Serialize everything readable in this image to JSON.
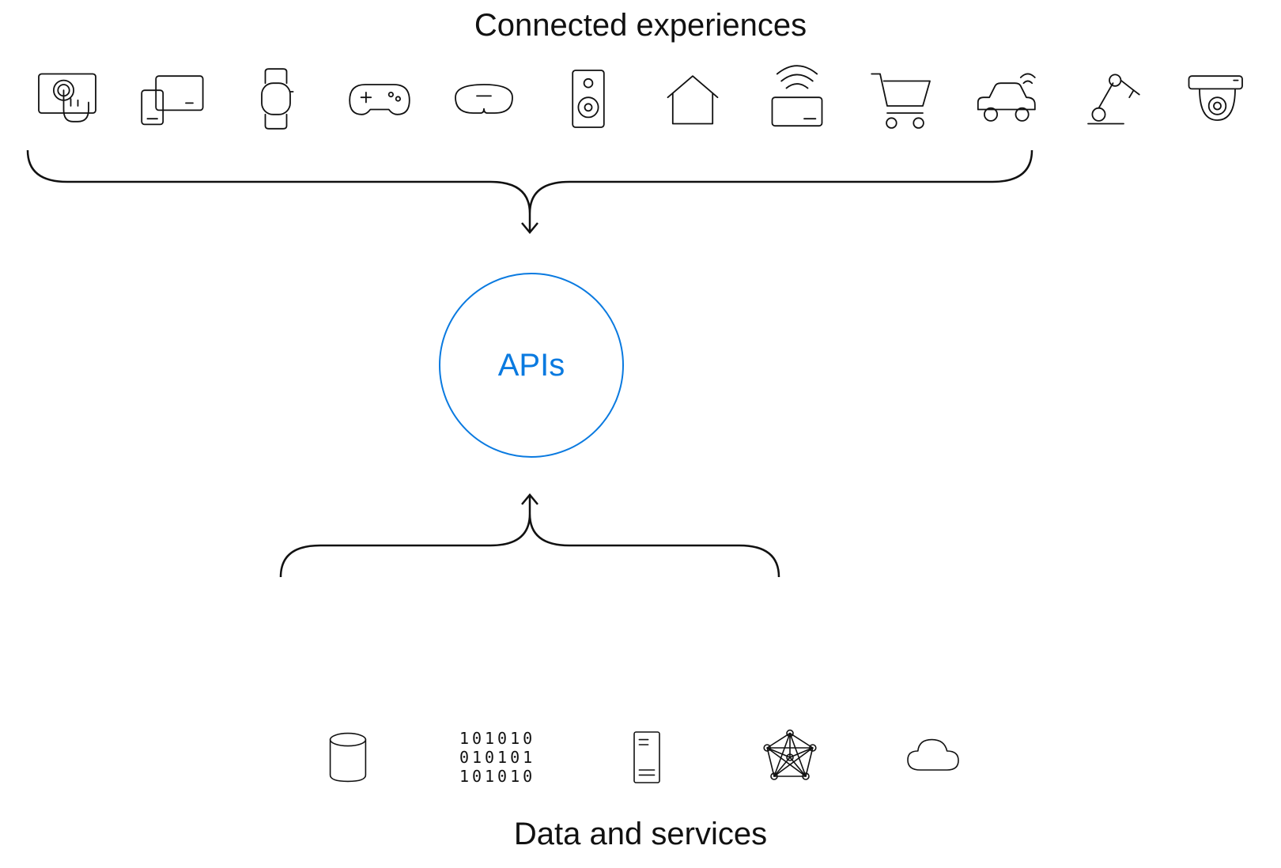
{
  "top_section": {
    "title": "Connected experiences",
    "icons": [
      "touchscreen-icon",
      "devices-icon",
      "smartwatch-icon",
      "game-controller-icon",
      "headset-icon",
      "speaker-icon",
      "home-icon",
      "contactless-card-icon",
      "shopping-cart-icon",
      "connected-car-icon",
      "robot-arm-icon",
      "security-camera-icon"
    ]
  },
  "center": {
    "label": "APIs",
    "accent_color": "#0a7ae0"
  },
  "bottom_section": {
    "title": "Data and services",
    "icons": [
      "database-icon",
      "binary-data-icon",
      "server-icon",
      "network-graph-icon",
      "cloud-icon"
    ],
    "binary_lines": [
      "101010",
      "010101",
      "101010"
    ]
  }
}
